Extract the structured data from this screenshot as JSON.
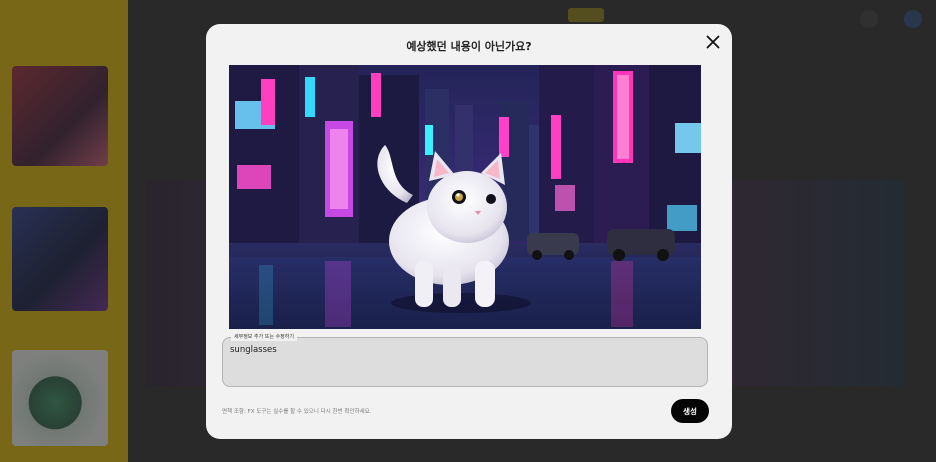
{
  "modal": {
    "title": "예상했던 내용이 아닌가요?",
    "close_icon": "close-icon",
    "image_alt_icon": "generated-image",
    "field": {
      "label": "세부정보 추가 또는 수정하기",
      "value": "sunglasses"
    },
    "disclaimer": "면책 조항: FX 도구는 실수를 할 수 있으니 다시 한번 확인하세요.",
    "generate_label": "생성"
  },
  "colors": {
    "modal_bg": "#f2f2f2",
    "button_bg": "#050505",
    "sidebar_accent": "#d9b300"
  }
}
